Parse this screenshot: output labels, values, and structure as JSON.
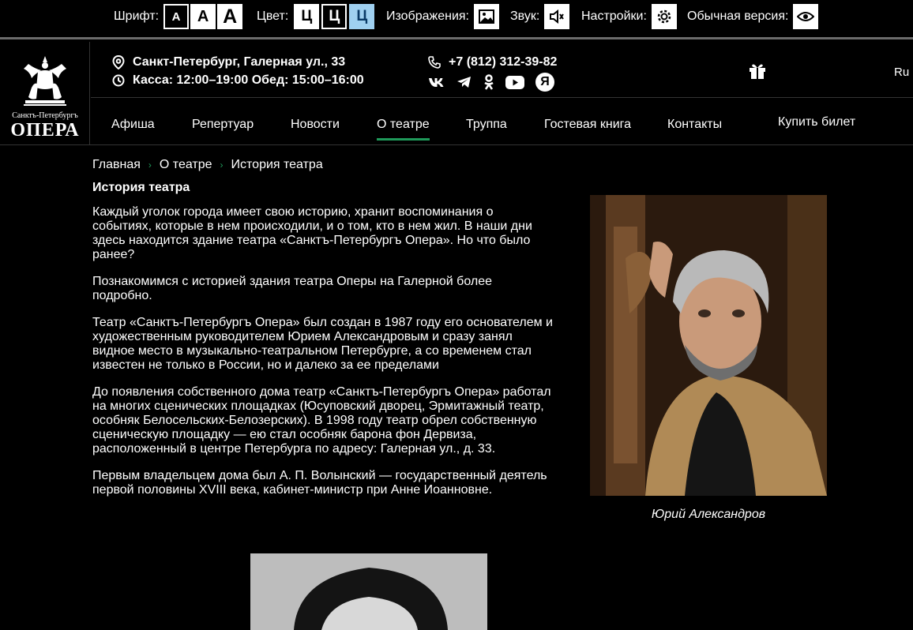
{
  "a11y": {
    "font_label": "Шрифт:",
    "font_buttons": [
      "А",
      "А",
      "А"
    ],
    "color_label": "Цвет:",
    "color_buttons": [
      "Ц",
      "Ц",
      "Ц"
    ],
    "images_label": "Изображения:",
    "sound_label": "Звук:",
    "settings_label": "Настройки:",
    "normal_label": "Обычная версия:"
  },
  "logo": {
    "subtitle": "Санктъ-Петербургъ",
    "title": "ОПЕРА"
  },
  "info": {
    "address": "Санкт-Петербург, Галерная ул., 33",
    "hours": "Касса: 12:00–19:00 Обед: 15:00–16:00",
    "phone": "+7 (812) 312-39-82",
    "social": [
      "vk-icon",
      "telegram-icon",
      "odnoklassniki-icon",
      "youtube-icon",
      "yandex-icon"
    ],
    "yandex_letter": "Я",
    "lang": "Ru"
  },
  "nav": {
    "items": [
      "Афиша",
      "Репертуар",
      "Новости",
      "О театре",
      "Труппа",
      "Гостевая книга",
      "Контакты"
    ],
    "active": "О театре",
    "buy": "Купить билет"
  },
  "breadcrumb": [
    "Главная",
    "О театре",
    "История театра"
  ],
  "page_title": "История театра",
  "paragraphs": [
    "Каждый уголок города имеет свою историю, хранит воспоминания о событиях, которые в нем происходили, и о том, кто в нем жил. В наши дни здесь находится здание театра «Санктъ-Петербургъ Опера». Но что было ранее?",
    "Познакомимся с историей здания театра Оперы на Галерной более подробно.",
    "Театр «Санктъ-Петербургъ Опера» был создан в 1987 году его основателем и художественным руководителем Юрием Александровым и сразу занял видное место в музыкально-театральном Петербурге, а со временем стал известен не только в России, но и далеко за ее пределами",
    "До появления собственного дома театр «Санктъ-Петербургъ Опера» работал на многих сценических площадках (Юсуповский дворец, Эрмитажный театр, особняк Белосельских-Белозерских). В 1998 году театр обрел собственную сценическую площадку — ею стал особняк барона фон Дервиза, расположенный в центре Петербурга по адресу: Галерная ул., д. 33.",
    "Первым владельцем дома был А. П. Волынский — государственный деятель первой половины XVIII века, кабинет-министр при Анне Иоанновне."
  ],
  "portrait_caption": "Юрий Александров",
  "colors": {
    "accent": "#1f9a5a",
    "bg": "#000000",
    "text": "#ffffff",
    "active_color_btn": "#9fd0f0"
  }
}
